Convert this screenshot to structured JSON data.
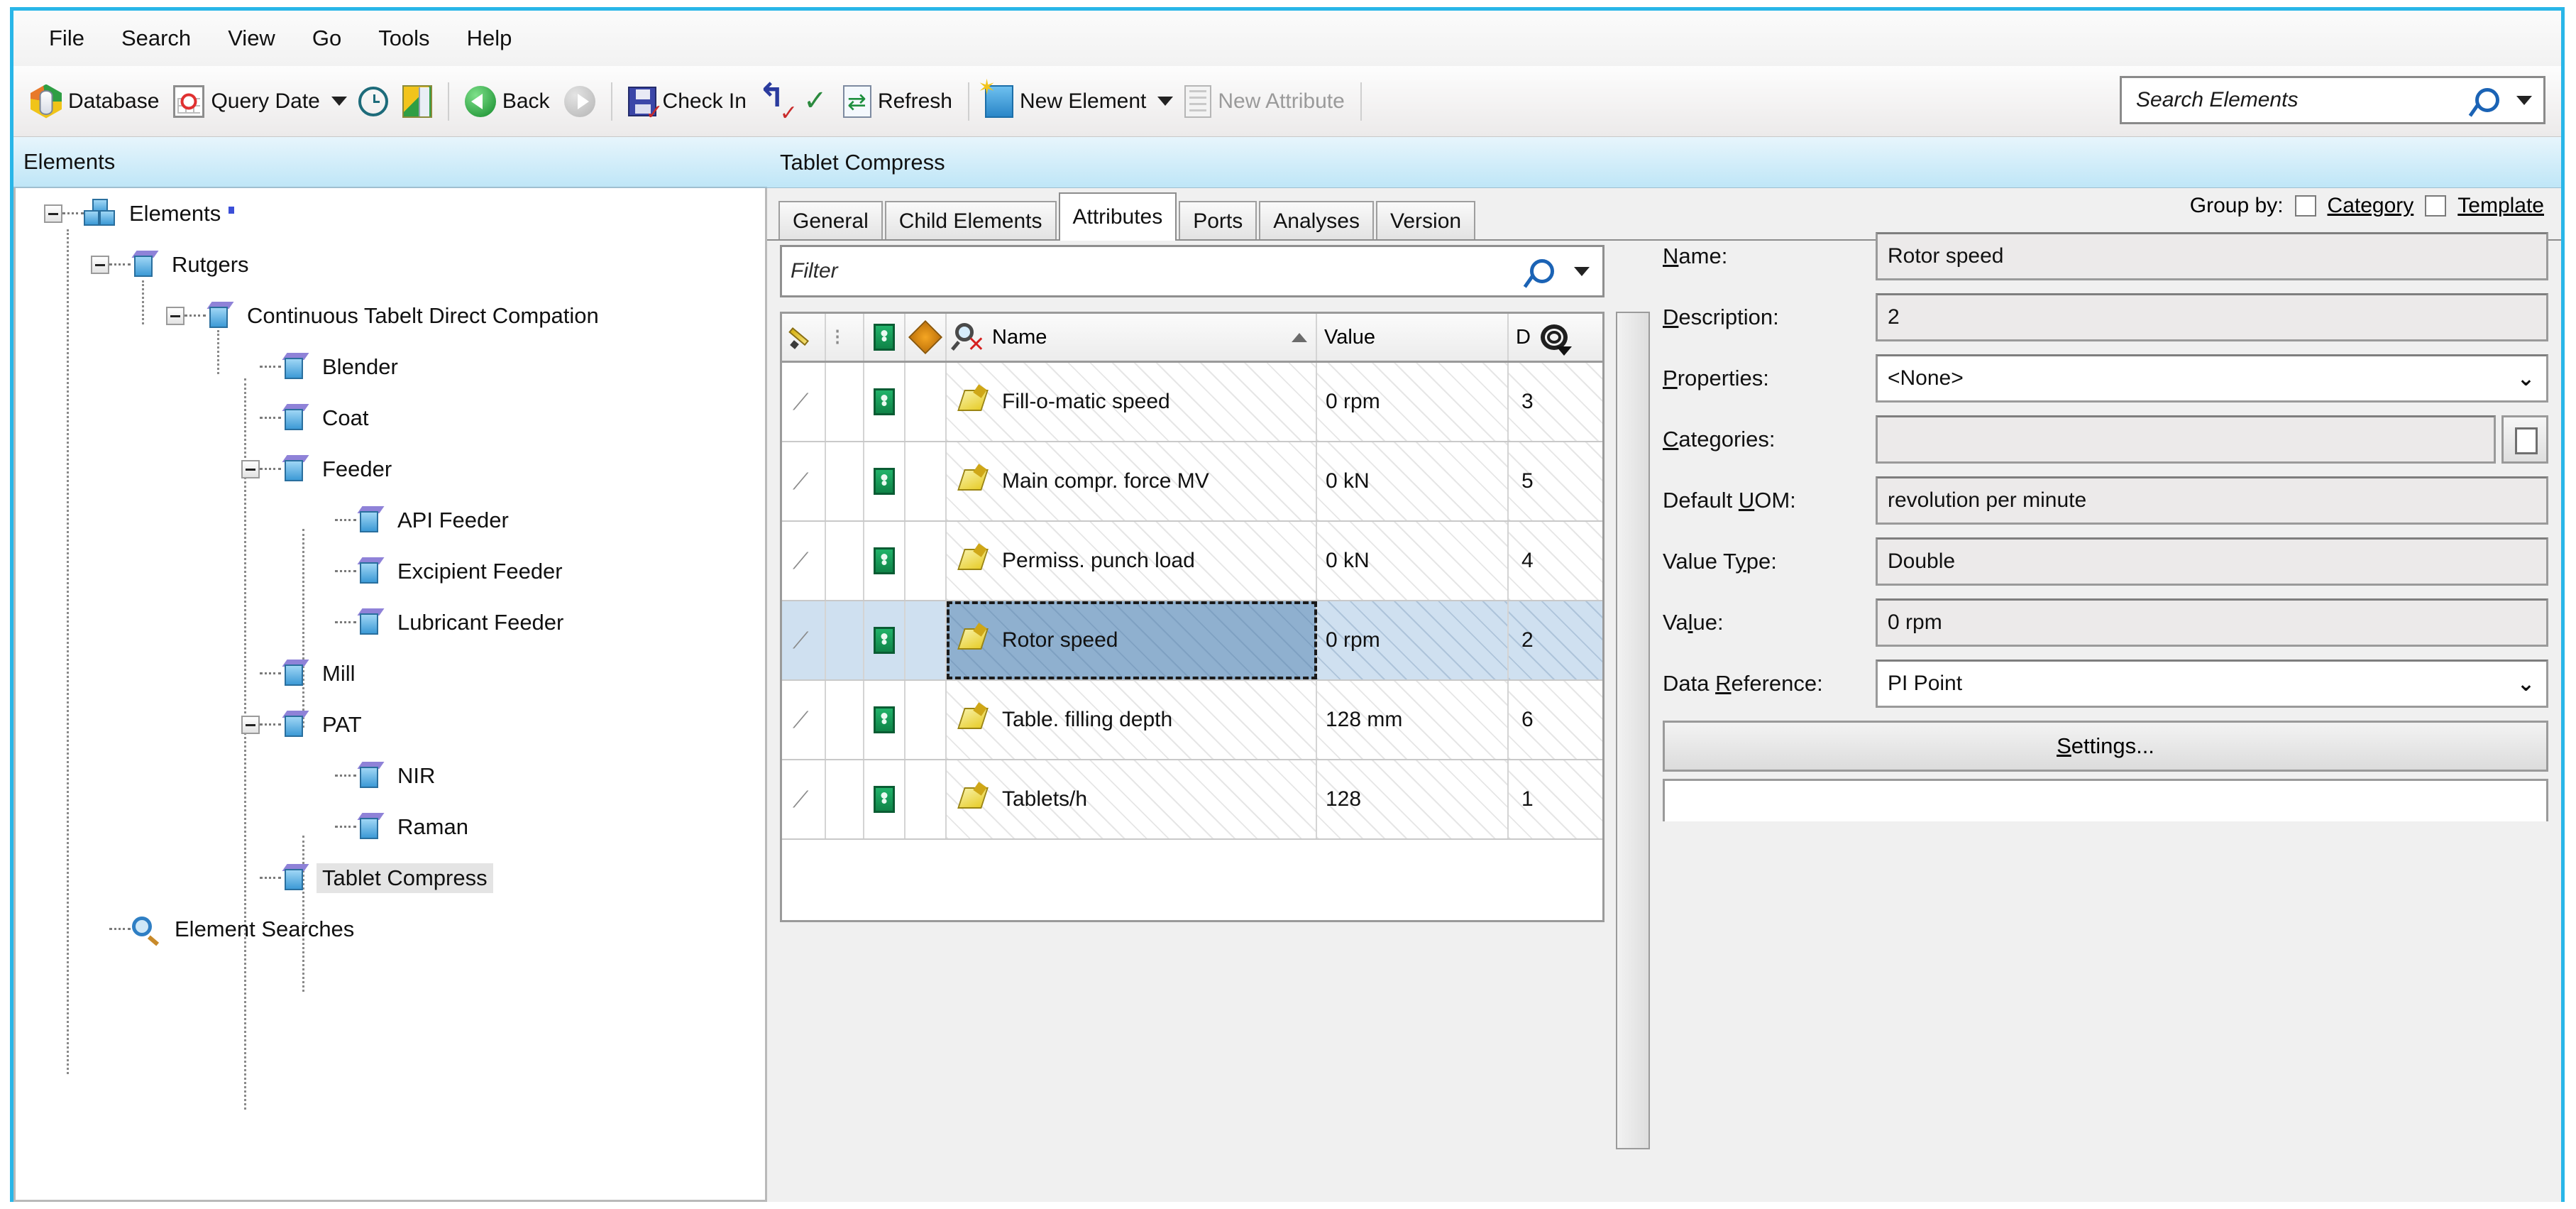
{
  "menu": {
    "items": [
      "File",
      "Search",
      "View",
      "Go",
      "Tools",
      "Help"
    ]
  },
  "toolbar": {
    "database": "Database",
    "query_date": "Query Date",
    "back": "Back",
    "check_in": "Check In",
    "refresh": "Refresh",
    "new_element": "New Element",
    "new_attribute": "New Attribute",
    "search_placeholder": "Search Elements"
  },
  "left_panel": {
    "title": "Elements",
    "tree": [
      {
        "label": "Elements",
        "depth": 0,
        "icon": "elements-stack-icon",
        "expander": true,
        "selected": false
      },
      {
        "label": "Rutgers",
        "depth": 1,
        "icon": "element-cube-icon",
        "expander": true,
        "selected": false
      },
      {
        "label": "Continuous Tabelt Direct Compation",
        "depth": 2,
        "icon": "element-cube-icon",
        "expander": true,
        "selected": false
      },
      {
        "label": "Blender",
        "depth": 3,
        "icon": "element-cube-icon",
        "expander": false,
        "selected": false
      },
      {
        "label": "Coat",
        "depth": 3,
        "icon": "element-cube-icon",
        "expander": false,
        "selected": false
      },
      {
        "label": "Feeder",
        "depth": 3,
        "icon": "element-cube-icon",
        "expander": true,
        "selected": false
      },
      {
        "label": "API Feeder",
        "depth": 4,
        "icon": "element-cube-icon",
        "expander": false,
        "selected": false
      },
      {
        "label": "Excipient Feeder",
        "depth": 4,
        "icon": "element-cube-icon",
        "expander": false,
        "selected": false
      },
      {
        "label": "Lubricant Feeder",
        "depth": 4,
        "icon": "element-cube-icon",
        "expander": false,
        "selected": false
      },
      {
        "label": "Mill",
        "depth": 3,
        "icon": "element-cube-icon",
        "expander": false,
        "selected": false
      },
      {
        "label": "PAT",
        "depth": 3,
        "icon": "element-cube-icon",
        "expander": true,
        "selected": false
      },
      {
        "label": "NIR",
        "depth": 4,
        "icon": "element-cube-icon",
        "expander": false,
        "selected": false
      },
      {
        "label": "Raman",
        "depth": 4,
        "icon": "element-cube-icon",
        "expander": false,
        "selected": false
      },
      {
        "label": "Tablet Compress",
        "depth": 3,
        "icon": "element-cube-icon",
        "expander": false,
        "selected": true
      },
      {
        "label": "Element Searches",
        "depth": 1,
        "icon": "element-searches-icon",
        "expander": false,
        "selected": false
      }
    ]
  },
  "main": {
    "title": "Tablet Compress",
    "tabs": [
      {
        "label": "General",
        "active": false
      },
      {
        "label": "Child Elements",
        "active": false
      },
      {
        "label": "Attributes",
        "active": true
      },
      {
        "label": "Ports",
        "active": false
      },
      {
        "label": "Analyses",
        "active": false
      },
      {
        "label": "Version",
        "active": false
      }
    ],
    "group_by": {
      "label": "Group by:",
      "category": "Category",
      "template": "Template",
      "category_checked": false,
      "template_checked": false
    },
    "filter": {
      "placeholder": "Filter",
      "value": ""
    },
    "table": {
      "columns": [
        "Name",
        "Value",
        "D"
      ],
      "sort_column": "Name",
      "sort_direction": "ascending",
      "rows": [
        {
          "name": "Fill-o-matic speed",
          "value": "0 rpm",
          "d": "3",
          "selected": false
        },
        {
          "name": "Main compr. force MV",
          "value": "0 kN",
          "d": "5",
          "selected": false
        },
        {
          "name": "Permiss. punch load",
          "value": "0 kN",
          "d": "4",
          "selected": false
        },
        {
          "name": "Rotor speed",
          "value": "0 rpm",
          "d": "2",
          "selected": true
        },
        {
          "name": "Table. filling depth",
          "value": "128 mm",
          "d": "6",
          "selected": false
        },
        {
          "name": "Tablets/h",
          "value": "128",
          "d": "1",
          "selected": false
        }
      ]
    }
  },
  "properties": {
    "name_label": "Name:",
    "name_value": "Rotor speed",
    "description_label": "Description:",
    "description_value": "2",
    "properties_label": "Properties:",
    "properties_value": "<None>",
    "categories_label": "Categories:",
    "categories_value": "",
    "default_uom_label": "Default UOM:",
    "default_uom_value": "revolution per minute",
    "value_type_label": "Value Type:",
    "value_type_value": "Double",
    "value_label": "Value:",
    "value_value": "0 rpm",
    "data_reference_label": "Data Reference:",
    "data_reference_value": "PI Point",
    "settings_button": "Settings..."
  },
  "colors": {
    "window_border": "#29b6e8",
    "header_gradient_top": "#e7f5fc",
    "header_gradient_bottom": "#bfe6f7",
    "selection_blue": "#cfe0f0",
    "focus_cell_blue": "#8fb0cf",
    "toolbar_bg": "#f0f0f0"
  }
}
